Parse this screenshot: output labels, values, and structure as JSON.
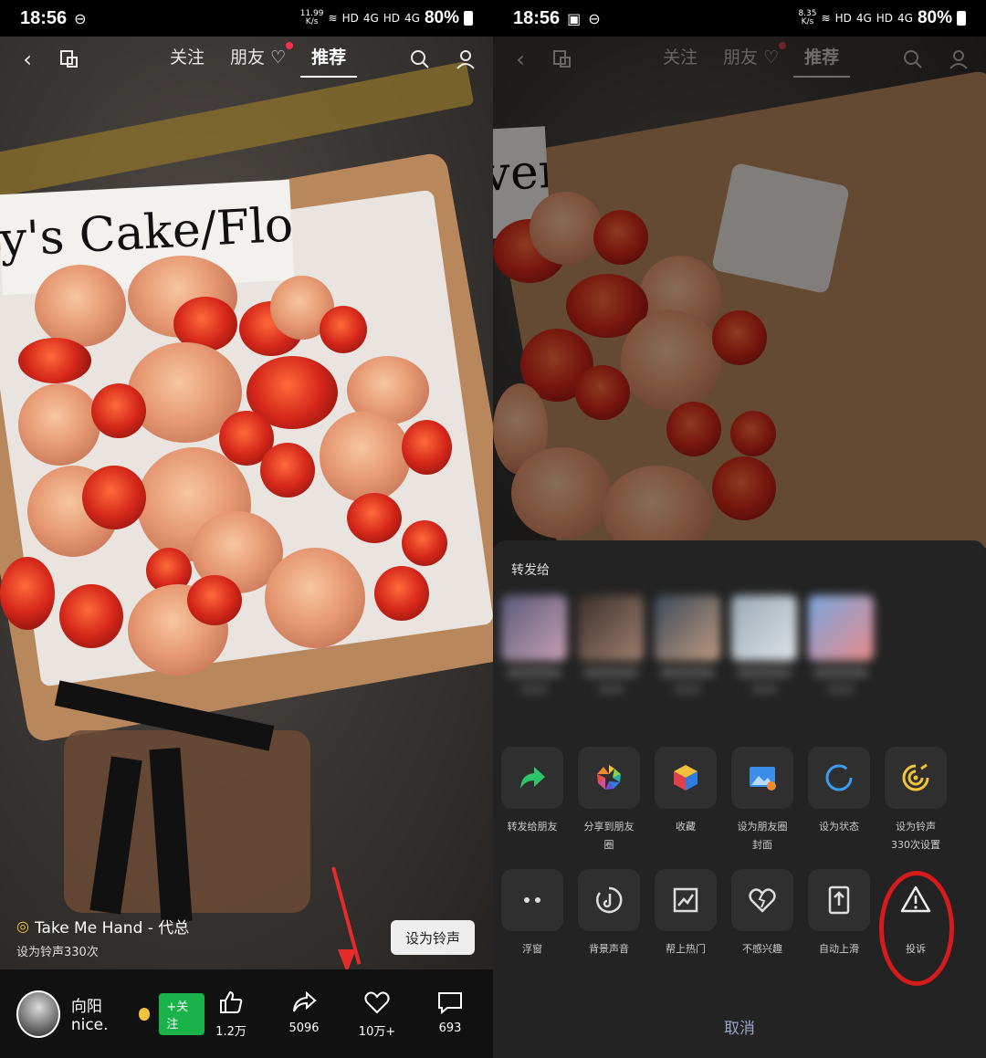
{
  "left": {
    "status_bar": {
      "time": "18:56",
      "net_speed_value": "11.99",
      "net_speed_unit": "K/s",
      "hd1": "HD",
      "sig1": "4G",
      "hd2": "HD",
      "sig2": "4G",
      "battery": "80%"
    },
    "nav": {
      "tabs": [
        "关注",
        "朋友",
        "推荐"
      ],
      "active_tab": "推荐"
    },
    "photo": {
      "card_text": "y's Cake/Flower"
    },
    "music": {
      "title": "Take Me Hand - 代总",
      "subtitle": "设为铃声330次"
    },
    "ringtone_button": "设为铃声",
    "bottom": {
      "username": "向阳nice.",
      "follow_label": "+关注",
      "actions": [
        {
          "icon": "like-icon",
          "count": "1.2万"
        },
        {
          "icon": "share-icon",
          "count": "5096"
        },
        {
          "icon": "favorite-icon",
          "count": "10万+"
        },
        {
          "icon": "comment-icon",
          "count": "693"
        }
      ]
    }
  },
  "right": {
    "status_bar": {
      "time": "18:56",
      "net_speed_value": "8.35",
      "net_speed_unit": "K/s",
      "hd1": "HD",
      "sig1": "4G",
      "hd2": "HD",
      "sig2": "4G",
      "battery": "80%"
    },
    "nav": {
      "tabs": [
        "关注",
        "朋友",
        "推荐"
      ]
    },
    "photo": {
      "card_text": "ver"
    },
    "sheet": {
      "title": "转发给",
      "row1": [
        {
          "label": "转发给朋友",
          "icon": "forward-arrow-icon"
        },
        {
          "label": "分享到朋友\n圈",
          "icon": "moments-shutter-icon"
        },
        {
          "label": "收藏",
          "icon": "cube-icon"
        },
        {
          "label": "设为朋友圈\n封面",
          "icon": "image-cover-icon"
        },
        {
          "label": "设为状态",
          "icon": "status-ring-icon"
        },
        {
          "label": "设为铃声\n330次设置",
          "icon": "ringtone-icon"
        }
      ],
      "row2": [
        {
          "label": "浮窗",
          "icon": "float-window-icon"
        },
        {
          "label": "背景声音",
          "icon": "background-sound-icon"
        },
        {
          "label": "帮上热门",
          "icon": "trending-chart-icon"
        },
        {
          "label": "不感兴趣",
          "icon": "broken-heart-icon"
        },
        {
          "label": "自动上滑",
          "icon": "auto-scroll-icon"
        },
        {
          "label": "投诉",
          "icon": "warning-icon"
        }
      ],
      "cancel": "取消"
    }
  },
  "colors": {
    "follow_green": "#19b34a",
    "annotation_red": "#e52a2a",
    "sheet_bg": "#232323"
  }
}
